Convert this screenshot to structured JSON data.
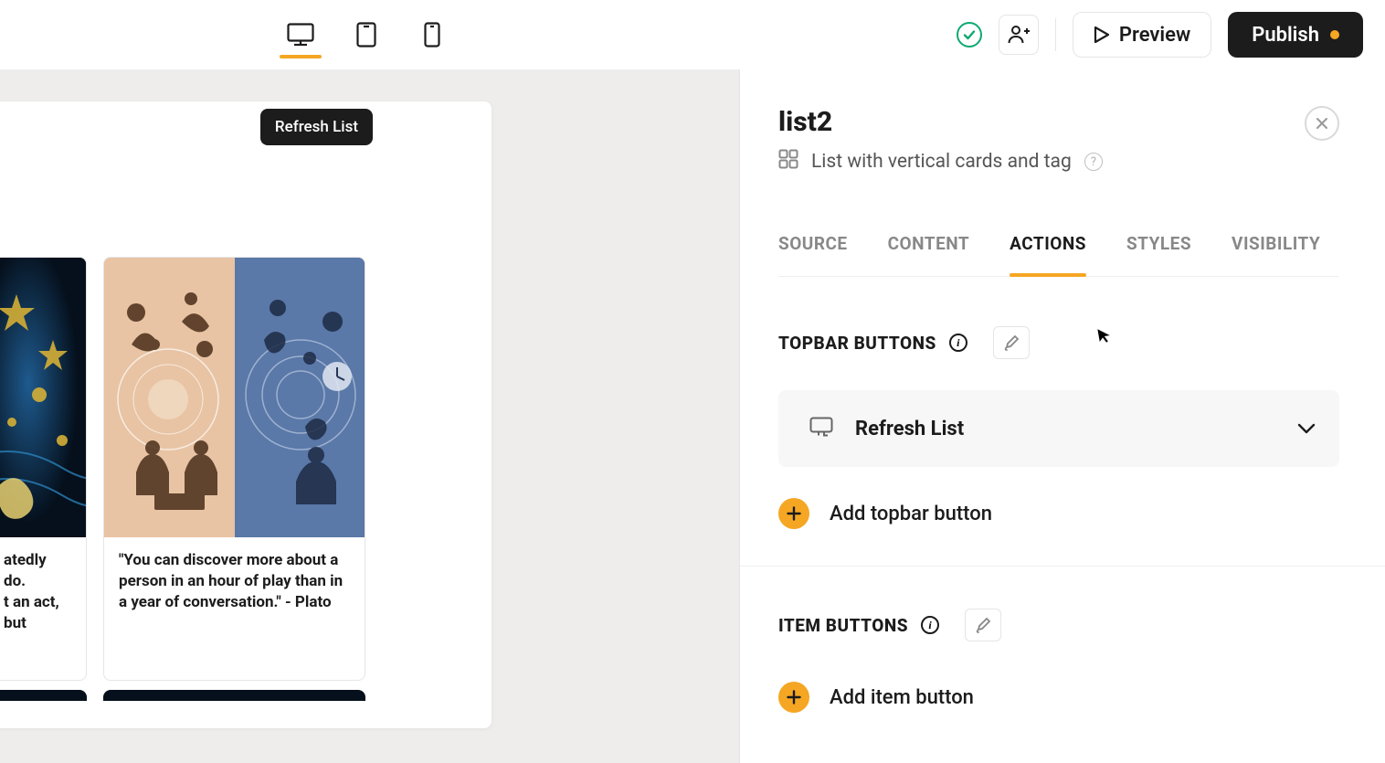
{
  "topbar": {
    "preview_label": "Preview",
    "publish_label": "Publish"
  },
  "canvas": {
    "refresh_pill": "Refresh List",
    "card_left_text": "atedly do.\nt an act, but",
    "card_right_text": "\"You can discover more about a person in an hour of play than in a year of conversation.\" - Plato"
  },
  "panel": {
    "title": "list2",
    "subtitle": "List with vertical cards and tag",
    "tabs": {
      "source": "SOURCE",
      "content": "CONTENT",
      "actions": "ACTIONS",
      "styles": "STYLES",
      "visibility": "VISIBILITY"
    },
    "sections": {
      "topbar_buttons": {
        "title": "TOPBAR BUTTONS",
        "rows": {
          "refresh": "Refresh List"
        },
        "add_label": "Add topbar button"
      },
      "item_buttons": {
        "title": "ITEM BUTTONS",
        "add_label": "Add item button"
      }
    }
  }
}
